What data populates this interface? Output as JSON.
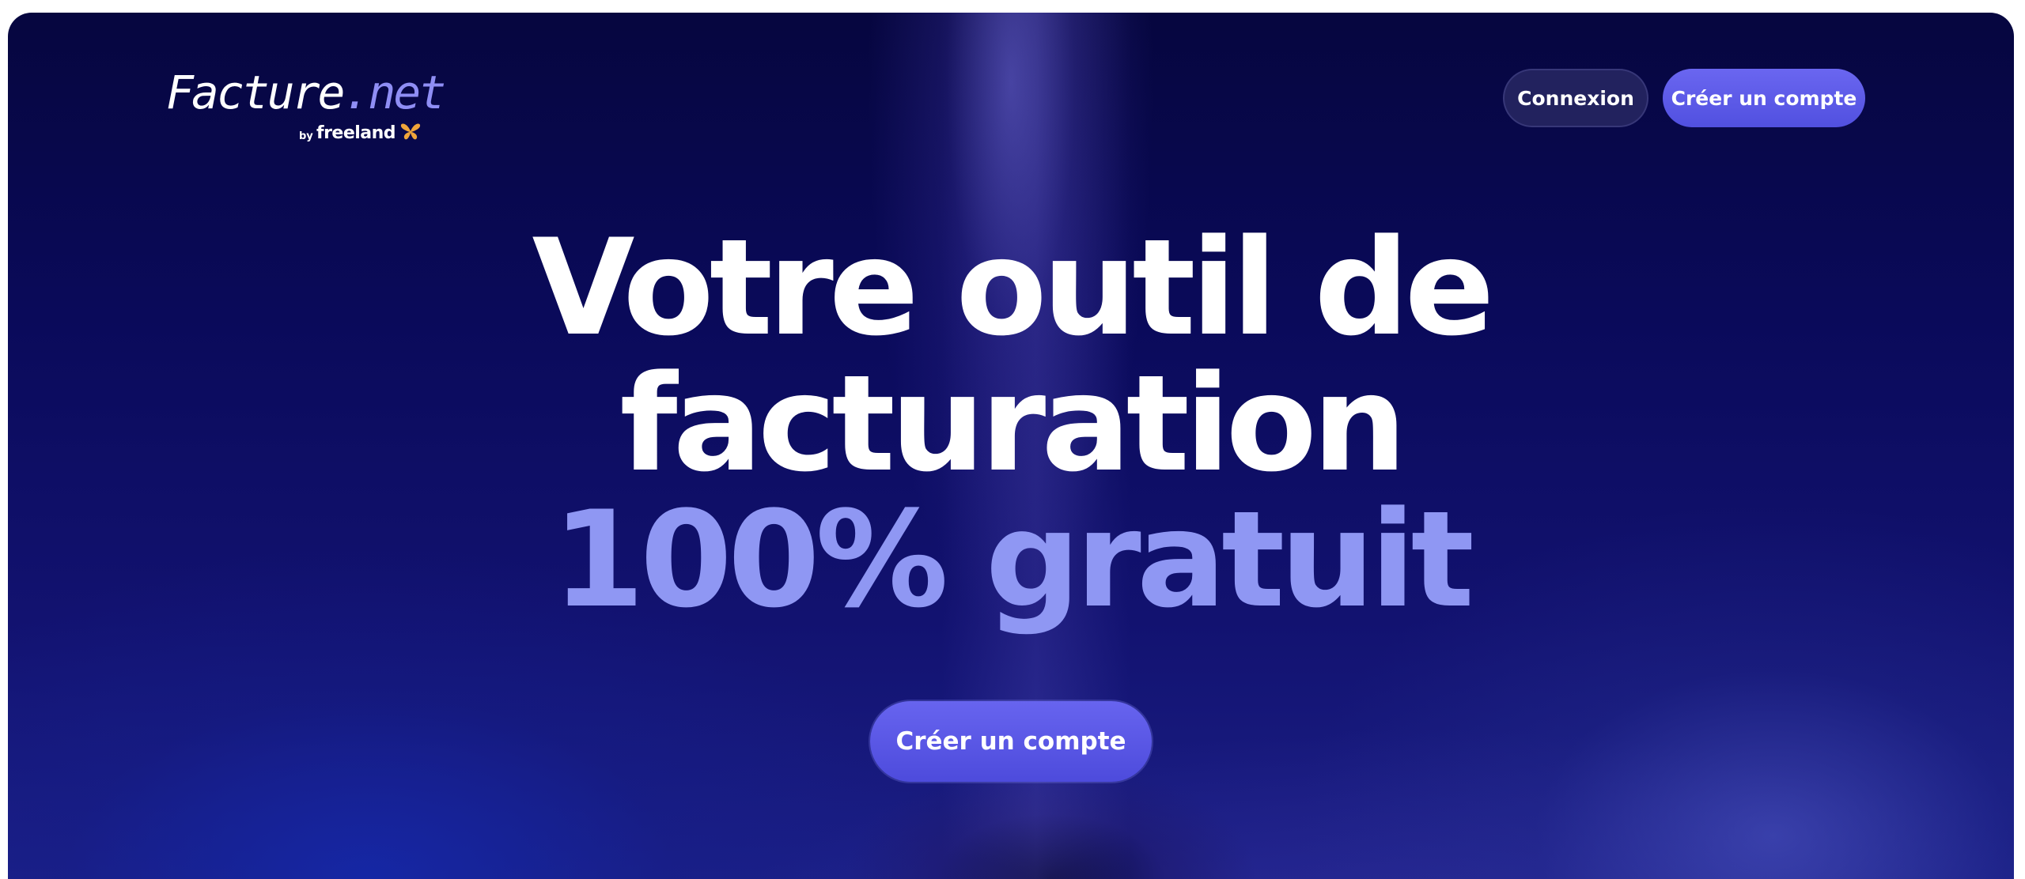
{
  "brand": {
    "word_main": "Facture",
    "word_ext": ".net",
    "by": "by",
    "parent": "freeland",
    "accent_color": "#8f8ef5",
    "butterfly_color": "#f0a53a"
  },
  "header": {
    "login_label": "Connexion",
    "signup_label": "Créer un compte"
  },
  "hero": {
    "headline_line1": "Votre outil de",
    "headline_line2": "facturation",
    "headline_line3": "100% gratuit",
    "cta_label": "Créer un compte",
    "headline_accent_color": "#8f97f3",
    "button_color": "#5a58e8"
  }
}
